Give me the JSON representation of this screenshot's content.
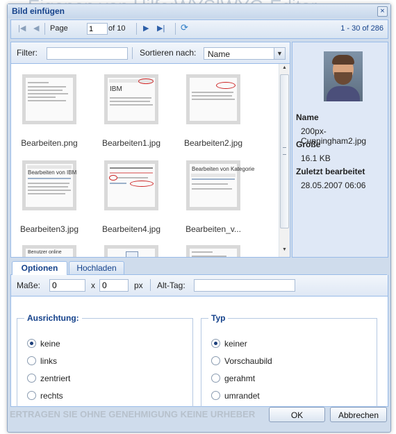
{
  "background": {
    "top_text": "Eigenen von Hilfe:WYSIWYG-Editor",
    "bottom_text": "ERTRAGEN SIE OHNE GENEHMIGUNG KEINE URHEBER"
  },
  "dialog": {
    "title": "Bild einfügen",
    "close_label": "×"
  },
  "pager": {
    "page_label": "Page",
    "page_value": "1",
    "of_label": "of 10",
    "display_info": "1 - 30 of 286"
  },
  "filter": {
    "filter_label": "Filter:",
    "filter_value": "",
    "sort_label": "Sortieren nach:",
    "sort_value": "Name"
  },
  "files": [
    {
      "name": "Bearbeiten.png"
    },
    {
      "name": "Bearbeiten1.jpg"
    },
    {
      "name": "Bearbeiten2.jpg"
    },
    {
      "name": "Bearbeiten3.jpg"
    },
    {
      "name": "Bearbeiten4.jpg"
    },
    {
      "name": "Bearbeiten_v..."
    }
  ],
  "thumb_text": {
    "ibm": "IBM",
    "edit_ibm": "Bearbeiten von IBM",
    "edit_kat": "Bearbeiten von Kategorie",
    "users_online": "Benutzer online"
  },
  "details": {
    "name_label": "Name",
    "name_value": "200px-Cunningham2.jpg",
    "size_label": "Größe",
    "size_value": "16.1 KB",
    "modified_label": "Zuletzt bearbeitet",
    "modified_value": "28.05.2007 06:06"
  },
  "tabs": [
    {
      "label": "Optionen"
    },
    {
      "label": "Hochladen"
    }
  ],
  "options": {
    "dims_label": "Maße:",
    "width_value": "0",
    "x_label": "x",
    "height_value": "0",
    "px_label": "px",
    "alt_label": "Alt-Tag:",
    "alt_value": "",
    "alignment": {
      "legend": "Ausrichtung:",
      "items": [
        {
          "label": "keine",
          "checked": true
        },
        {
          "label": "links",
          "checked": false
        },
        {
          "label": "zentriert",
          "checked": false
        },
        {
          "label": "rechts",
          "checked": false
        }
      ]
    },
    "type": {
      "legend": "Typ",
      "items": [
        {
          "label": "keiner",
          "checked": true
        },
        {
          "label": "Vorschaubild",
          "checked": false
        },
        {
          "label": "gerahmt",
          "checked": false
        },
        {
          "label": "umrandet",
          "checked": false
        }
      ]
    }
  },
  "buttons": {
    "ok": "OK",
    "cancel": "Abbrechen"
  },
  "colors": {
    "accent": "#15428b",
    "border": "#99bbe8",
    "highlight_red": "#cc2222"
  }
}
